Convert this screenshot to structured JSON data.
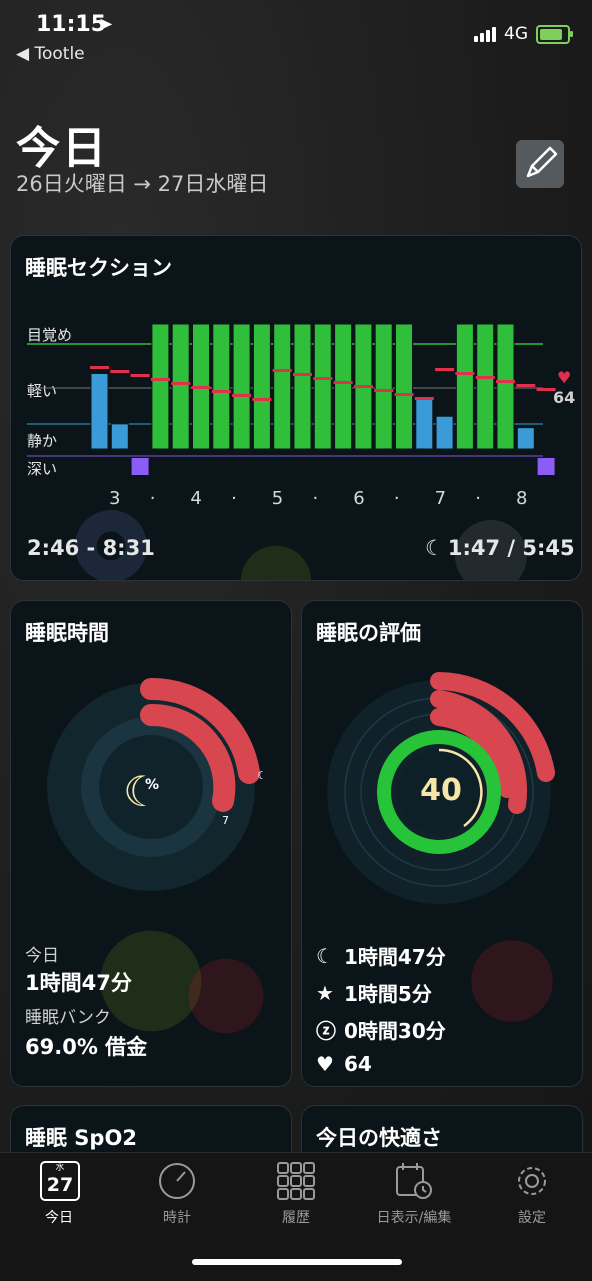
{
  "status_bar": {
    "time": "11:15",
    "back_app": "Tootle",
    "network": "4G"
  },
  "header": {
    "title": "今日",
    "date_range": "26日火曜日 → 27日水曜日"
  },
  "sleep_section": {
    "title": "睡眠セクション",
    "levels": [
      "目覚め",
      "軽い",
      "静か",
      "深い"
    ],
    "hour_labels": [
      "3",
      "·",
      "4",
      "·",
      "5",
      "·",
      "6",
      "·",
      "7",
      "·",
      "8"
    ],
    "time_range": "2:46 - 8:31",
    "sleep_ratio": "1:47 / 5:45",
    "heart_rate": "64",
    "bars": [
      {
        "stage": "light",
        "top": 0.1
      },
      {
        "stage": "light",
        "top": 0.63
      },
      {
        "stage": "deep",
        "top": 0.0
      },
      {
        "stage": "awake",
        "top": 0.0
      },
      {
        "stage": "awake",
        "top": 0.0
      },
      {
        "stage": "awake",
        "top": 0.0
      },
      {
        "stage": "awake",
        "top": 0.0
      },
      {
        "stage": "awake",
        "top": 0.0
      },
      {
        "stage": "awake",
        "top": 0.0
      },
      {
        "stage": "awake",
        "top": 0.0
      },
      {
        "stage": "awake",
        "top": 0.0
      },
      {
        "stage": "awake",
        "top": 0.0
      },
      {
        "stage": "awake",
        "top": 0.0
      },
      {
        "stage": "awake",
        "top": 0.0
      },
      {
        "stage": "awake",
        "top": 0.0
      },
      {
        "stage": "awake",
        "top": 0.0
      },
      {
        "stage": "light",
        "top": 0.35
      },
      {
        "stage": "light",
        "top": 0.55
      },
      {
        "stage": "awake",
        "top": 0.0
      },
      {
        "stage": "awake",
        "top": 0.0
      },
      {
        "stage": "awake",
        "top": 0.0
      },
      {
        "stage": "light",
        "top": 0.67
      },
      {
        "stage": "deep",
        "top": 0.0
      }
    ]
  },
  "sleep_time": {
    "title": "睡眠時間",
    "today_label": "今日",
    "today_value": "1時間47分",
    "bank_label": "睡眠バンク",
    "bank_value": "69.0% 借金",
    "center_symbol": "%",
    "ring_badge": "7"
  },
  "sleep_rating": {
    "title": "睡眠の評価",
    "score": "40",
    "stats": [
      {
        "icon": "moon-icon",
        "value": "1時間47分"
      },
      {
        "icon": "star-icon",
        "value": "1時間5分"
      },
      {
        "icon": "z-icon",
        "value": "0時間30分"
      },
      {
        "icon": "heart-icon",
        "value": "64"
      }
    ]
  },
  "bottom_cards": {
    "spo2_title": "睡眠 SpO2",
    "comfort_title": "今日の快適さ"
  },
  "tabbar": {
    "calendar_weekday": "水",
    "calendar_day": "27",
    "items": [
      {
        "label": "今日"
      },
      {
        "label": "時計"
      },
      {
        "label": "履歴"
      },
      {
        "label": "日表示/編集"
      },
      {
        "label": "設定"
      }
    ]
  },
  "colors": {
    "awake": "#2fbf3a",
    "light": "#3a9bd8",
    "deep": "#8b5cf6",
    "heart": "#e0304e",
    "ring_red": "#d8474f",
    "ring_green": "#27c43a"
  }
}
